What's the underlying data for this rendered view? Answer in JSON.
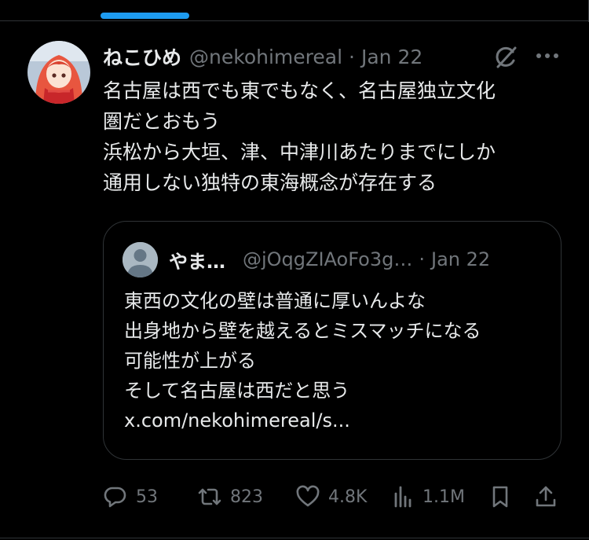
{
  "tweet": {
    "display_name": "ねこひめ",
    "handle": "@nekohimereal",
    "dot": "·",
    "date": "Jan 22",
    "text_lines": [
      "名古屋は西でも東でもなく、名古屋独立文化",
      "圏だとおもう",
      "浜松から大垣、津、中津川あたりまでにしか",
      "通用しない独特の東海概念が存在する"
    ]
  },
  "quote": {
    "display_name": "やま…",
    "handle": "@jOqgZIAoFo3g…",
    "dot": "·",
    "date": "Jan 22",
    "text_lines": [
      "東西の文化の壁は普通に厚いんよな",
      "出身地から壁を越えるとミスマッチになる",
      "可能性が上がる",
      "そして名古屋は西だと思う",
      "x.com/nekohimereal/s..."
    ]
  },
  "actions": {
    "replies": "53",
    "reposts": "823",
    "likes": "4.8K",
    "views": "1.1M"
  },
  "icons": [
    "avatar",
    "grok-icon",
    "more-icon",
    "reply-icon",
    "repost-icon",
    "like-icon",
    "views-icon",
    "bookmark-icon",
    "share-icon"
  ],
  "colors": {
    "background": "#000000",
    "text": "#e7e9ea",
    "secondary": "#71767b",
    "accent": "#1d9bf0",
    "border": "#2f3336"
  }
}
